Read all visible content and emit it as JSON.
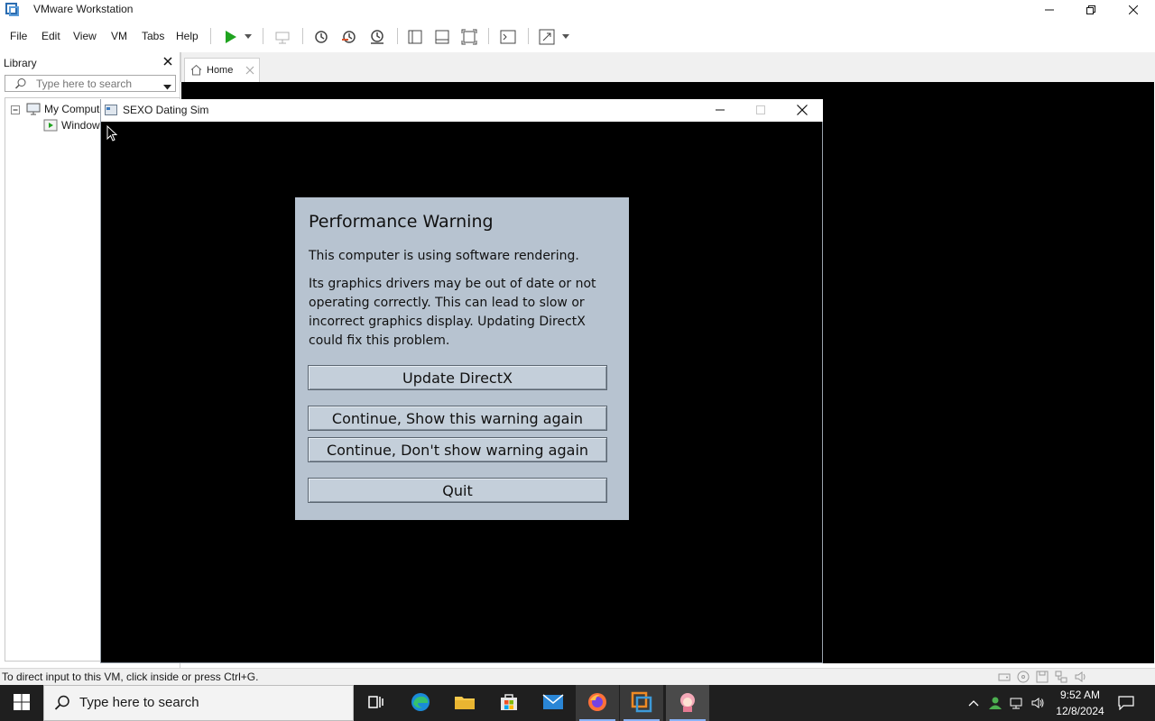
{
  "app": {
    "title": "VMware Workstation"
  },
  "menu": {
    "items": [
      "File",
      "Edit",
      "View",
      "VM",
      "Tabs",
      "Help"
    ]
  },
  "library": {
    "title": "Library",
    "search_placeholder": "Type here to search",
    "tree": {
      "root": "My Computer",
      "child": "Windows"
    }
  },
  "tabs": {
    "home_label": "Home"
  },
  "guest": {
    "window_title": "SEXO Dating Sim",
    "dialog": {
      "title": "Performance Warning",
      "line1": "This computer is using software rendering.",
      "line2": "Its graphics drivers may be out of date or not operating correctly. This can lead to slow or incorrect graphics display. Updating DirectX could fix this problem.",
      "buttons": {
        "update": "Update DirectX",
        "continue_show": "Continue, Show this warning again",
        "continue_hide": "Continue, Don't show warning again",
        "quit": "Quit"
      }
    }
  },
  "status": {
    "text": "To direct input to this VM, click inside or press Ctrl+G."
  },
  "taskbar": {
    "search_placeholder": "Type here to search",
    "time": "9:52 AM",
    "date": "12/8/2024"
  },
  "colors": {
    "dialog_bg": "#b7c3d0",
    "accent_green": "#1fa31f",
    "vmware_orange": "#f08a24"
  }
}
